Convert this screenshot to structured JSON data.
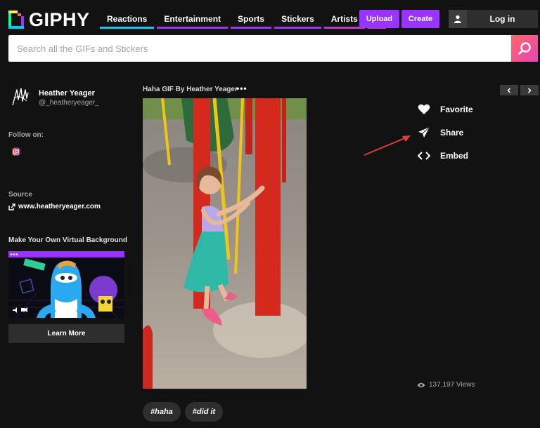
{
  "header": {
    "logo_text": "GIPHY",
    "nav": [
      {
        "label": "Reactions"
      },
      {
        "label": "Entertainment"
      },
      {
        "label": "Sports"
      },
      {
        "label": "Stickers"
      },
      {
        "label": "Artists"
      }
    ],
    "more_label": "⋮",
    "upload_label": "Upload",
    "create_label": "Create",
    "login_label": "Log in"
  },
  "search": {
    "placeholder": "Search all the GIFs and Stickers",
    "value": ""
  },
  "sidebar": {
    "user_name": "Heather Yeager",
    "user_handle": "@_heatheryeager_",
    "follow_label": "Follow on:",
    "source_label": "Source",
    "source_link": "www.heatheryeager.com",
    "vb_title": "Make Your Own Virtual Background",
    "learn_more_label": "Learn More"
  },
  "gif": {
    "title": "Haha GIF By Heather Yeager",
    "more": "•••"
  },
  "actions": {
    "favorite": "Favorite",
    "share": "Share",
    "embed": "Embed"
  },
  "views": "137,197 Views",
  "tags": [
    "#haha",
    "#did it"
  ],
  "colors": {
    "background": "#121212",
    "accent_purple": "#9933ff",
    "search_gradient_start": "#ff6666",
    "search_gradient_end": "#e646b6",
    "annotation_arrow": "#e03c3c"
  },
  "icons": {
    "logo": "giphy-logo-icon",
    "search": "search-icon",
    "user": "user-icon",
    "instagram": "instagram-icon",
    "external_link": "external-link-icon",
    "favorite": "heart-icon",
    "share": "paper-plane-icon",
    "embed": "code-brackets-icon",
    "views": "eye-icon",
    "prev": "chevron-left-icon",
    "next": "chevron-right-icon"
  }
}
